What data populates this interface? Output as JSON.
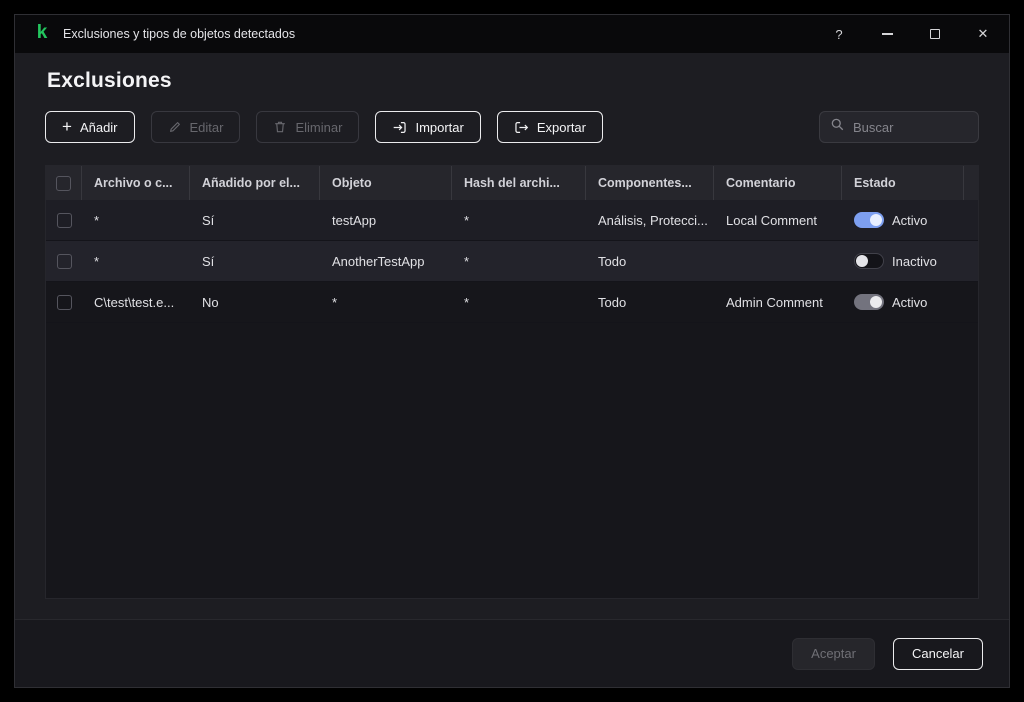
{
  "window": {
    "title": "Exclusiones y tipos de objetos detectados",
    "logo_glyph": "k",
    "controls": {
      "help": "?",
      "close": "✕"
    }
  },
  "page": {
    "title": "Exclusiones"
  },
  "toolbar": {
    "add": "Añadir",
    "add_plus": "+",
    "edit": "Editar",
    "delete": "Eliminar",
    "import": "Importar",
    "export": "Exportar",
    "search_placeholder": "Buscar"
  },
  "table": {
    "columns": [
      "Archivo o c...",
      "Añadido por el...",
      "Objeto",
      "Hash del archi...",
      "Componentes...",
      "Comentario",
      "Estado"
    ],
    "rows": [
      {
        "file": "*",
        "added": "Sí",
        "object": "testApp",
        "hash": "*",
        "components": "Análisis, Protecci...",
        "comment": "Local Comment",
        "state": "Activo",
        "toggle_class": "toggle on"
      },
      {
        "file": "*",
        "added": "Sí",
        "object": "AnotherTestApp",
        "hash": "*",
        "components": "Todo",
        "comment": "",
        "state": "Inactivo",
        "toggle_class": "toggle off"
      },
      {
        "file": "C\\test\\test.e...",
        "added": "No",
        "object": "*",
        "hash": "*",
        "components": "Todo",
        "comment": "Admin Comment",
        "state": "Activo",
        "toggle_class": "toggle gray-on"
      }
    ]
  },
  "footer": {
    "ok": "Aceptar",
    "cancel": "Cancelar"
  },
  "colors": {
    "accent_green": "#23c55e",
    "toggle_on": "#7d9ff0"
  }
}
